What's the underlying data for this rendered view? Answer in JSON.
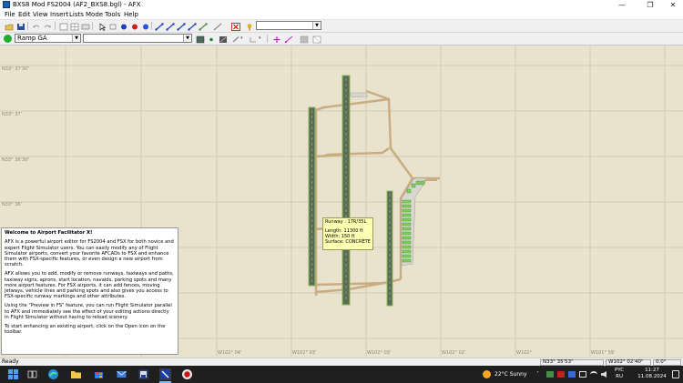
{
  "window": {
    "title": "BXS8 Mod FS2004 (AF2_BXS8.bgl) - AFX",
    "minimize_glyph": "—",
    "maximize_glyph": "❐",
    "close_glyph": "✕"
  },
  "menu": [
    "File",
    "Edit",
    "View",
    "Insert",
    "Lists",
    "Mode",
    "Tools",
    "Help"
  ],
  "toolbar2": {
    "object_type_select": "Ramp GA",
    "second_select": ""
  },
  "map": {
    "lat_labels": [
      "N33° 37'30\"",
      "N33° 37'",
      "N33° 36'30\"",
      "N33° 36'"
    ],
    "lon_labels": [
      "W102° 04'",
      "W102° 03'",
      "W102° 03'",
      "W102° 02'",
      "W102°",
      "W101° 59'"
    ]
  },
  "tooltip": {
    "runway": "Runway : 17R/35L",
    "length": "Length:   11300 ft",
    "width": "Width:    150 ft",
    "surface": "Surface: CONCRETE"
  },
  "welcome": {
    "title": "Welcome to Airport Facilitator X!",
    "paragraphs": [
      "AFX is a powerful airport editor for FS2004 and FSX for both novice and expert Flight Simulator users. You can easily modify any of Flight Simulator airports, convert your favorite AFCADs to FSX and enhance them with FSX-specific features, or even design a new airport from scratch.",
      "AFX allows you to add, modify or remove runways, taxiways and paths, taxiway signs, aprons, start location, navaids, parking spots and many more airport features. For FSX airports, it can add fences, moving jetways, vehicle lines and parking spots and also gives you access to FSX-specific runway markings and other attributes.",
      "Using the \"Preview in FS\" feature, you can run Flight Simulator parallel to AFX and immediately see the effect of your editing actions directly in Flight Simulator without having to reload scenery.",
      "To start enhancing an existing airport, click on the Open icon on the toolbar."
    ]
  },
  "status": {
    "text": "Ready",
    "lat": "N33° 35'53\"",
    "lon": "W102° 02'40\"",
    "heading": "0.0°"
  },
  "taskbar": {
    "weather": "22°C  Sunny",
    "lang_top": "PYC",
    "lang_bottom": "RU",
    "time": "11:27",
    "date": "11.08.2024"
  },
  "colors": {
    "map_bg": "#e9e2cc",
    "grid": "#d2cab1",
    "runway": "#5d6b52",
    "runway_edge": "#7fbf5a",
    "taxiway": "#c9ad82",
    "taskbar": "#1f1f1f"
  }
}
